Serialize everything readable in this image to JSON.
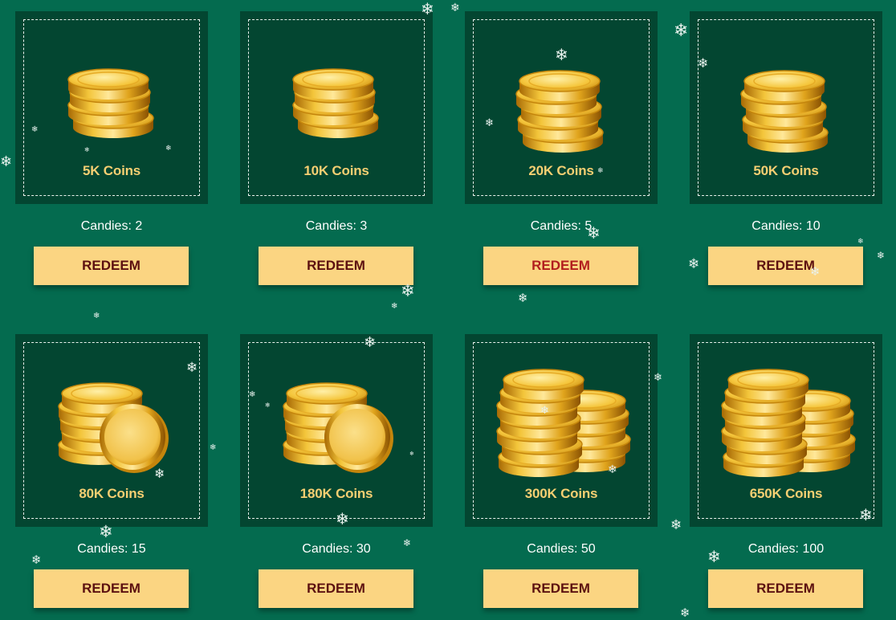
{
  "offers": [
    {
      "name": "5K Coins",
      "price_label": "Candies: 2",
      "button_label": "REDEEM",
      "art": "stack-3-coins-icon"
    },
    {
      "name": "10K Coins",
      "price_label": "Candies: 3",
      "button_label": "REDEEM",
      "art": "stack-3-coins-icon"
    },
    {
      "name": "20K Coins",
      "price_label": "Candies: 5",
      "button_label": "REDEEM",
      "art": "stack-4-coins-icon"
    },
    {
      "name": "50K Coins",
      "price_label": "Candies: 10",
      "button_label": "REDEEM",
      "art": "stack-4-coins-icon"
    },
    {
      "name": "80K Coins",
      "price_label": "Candies: 15",
      "button_label": "REDEEM",
      "art": "stack-with-coin-icon"
    },
    {
      "name": "180K Coins",
      "price_label": "Candies: 30",
      "button_label": "REDEEM",
      "art": "stack-with-coin-icon"
    },
    {
      "name": "300K Coins",
      "price_label": "Candies: 50",
      "button_label": "REDEEM",
      "art": "double-stack-coins-icon"
    },
    {
      "name": "650K Coins",
      "price_label": "Candies: 100",
      "button_label": "REDEEM",
      "art": "double-stack-coins-icon"
    }
  ],
  "colors": {
    "background": "#046b4f",
    "card": "#034631",
    "coin_label": "#f6cf72",
    "button": "#fbd582",
    "button_text": "#5c1010",
    "button_text_hover": "#b21e1e"
  },
  "decoration": "snowflake-icon"
}
